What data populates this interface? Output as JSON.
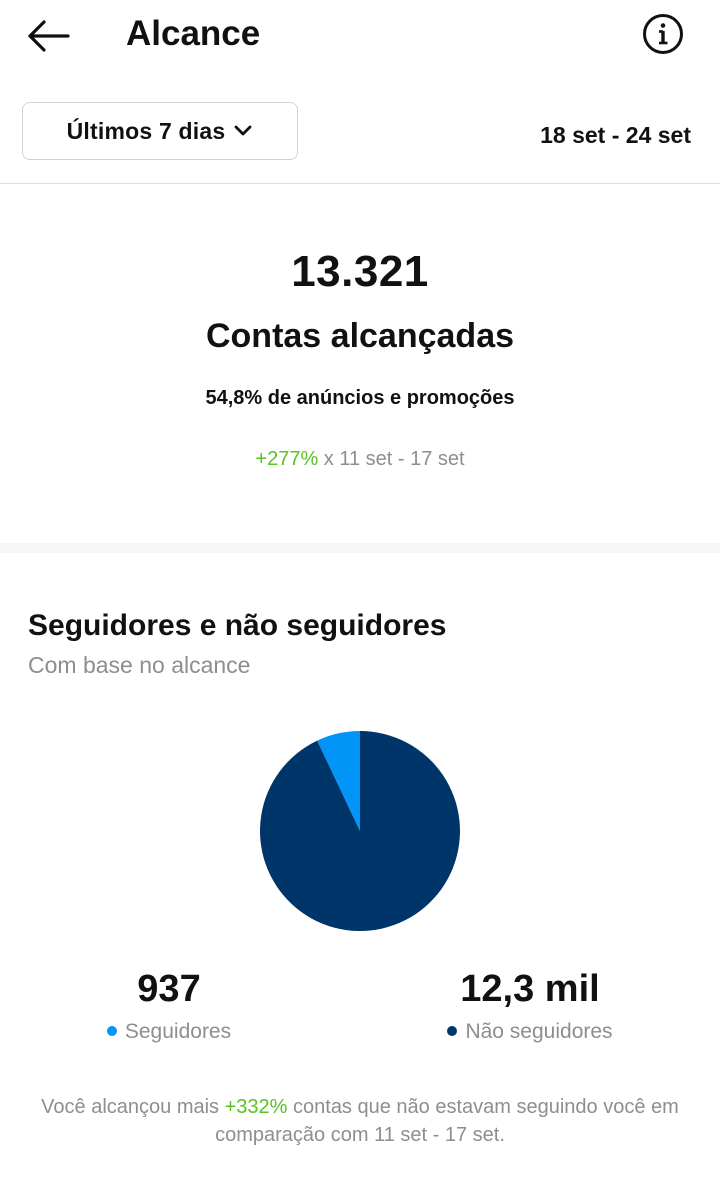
{
  "header": {
    "title": "Alcance",
    "back_icon": "arrow-left-icon",
    "info_icon": "info-circle-icon"
  },
  "filter": {
    "selected": "Últimos 7 dias",
    "date_range": "18 set - 24 set"
  },
  "summary": {
    "value": "13.321",
    "label": "Contas alcançadas",
    "ads_note": "54,8% de anúncios e promoções",
    "change": "+277%",
    "change_suffix": " x 11 set - 17 set"
  },
  "followers_section": {
    "title": "Seguidores e não seguidores",
    "subtitle": "Com base no alcance",
    "followers_value": "937",
    "followers_label": "Seguidores",
    "non_followers_value": "12,3 mil",
    "non_followers_label": "Não seguidores",
    "note_prefix": "Você alcançou mais ",
    "note_highlight": "+332%",
    "note_suffix": " contas que não estavam seguindo você em comparação com 11 set - 17 set."
  },
  "chart_data": {
    "type": "pie",
    "slices": [
      {
        "label": "Seguidores",
        "value": 937,
        "color": "#0095f6"
      },
      {
        "label": "Não seguidores",
        "value": 12384,
        "color": "#003569"
      }
    ]
  },
  "colors": {
    "positive": "#58c322",
    "followers": "#0095f6",
    "non_followers": "#003569"
  }
}
